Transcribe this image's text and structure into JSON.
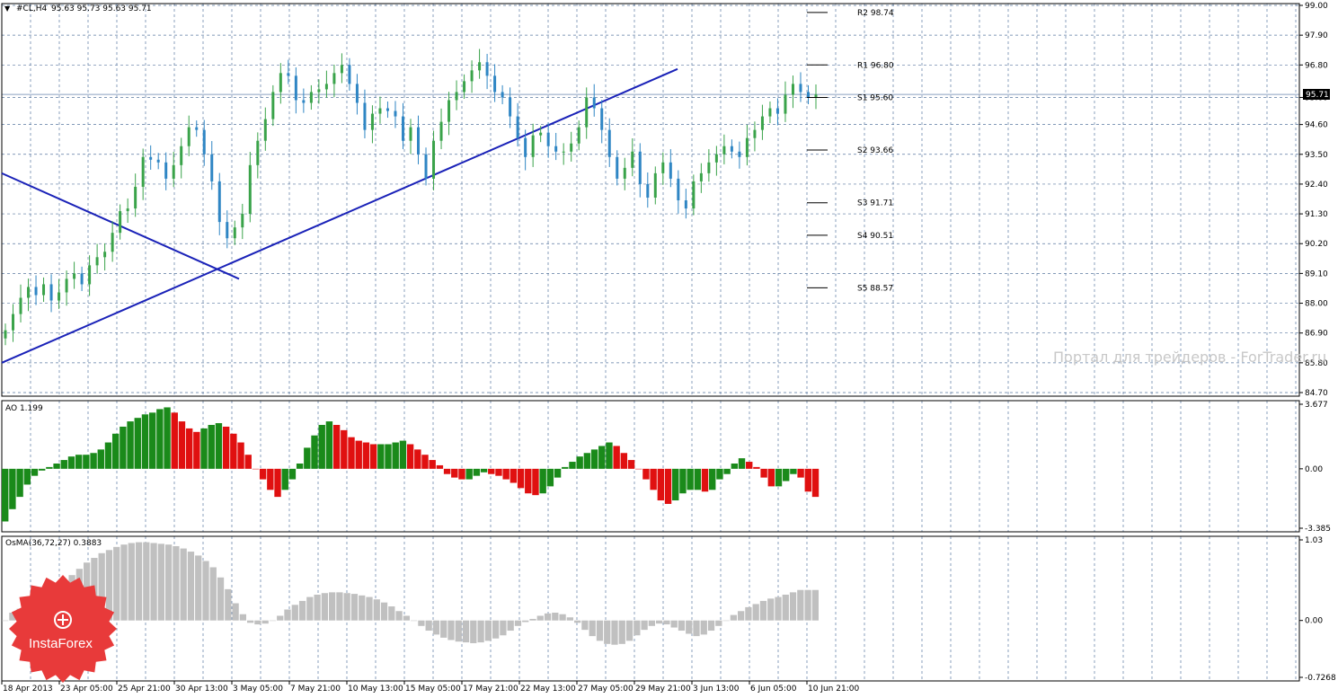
{
  "header": {
    "symbol_label": "#CL,H4",
    "ohlc_label": "95.63 95.73 95.63 95.71"
  },
  "current_price_label": "95.71",
  "watermark": "Портал для трейдеров - ForTrader.ru",
  "logo": {
    "name": "InstaForex",
    "text": "InstaForex",
    "color": "#e83a3a"
  },
  "colors": {
    "bull": "#3aa34a",
    "bear": "#2f86c4",
    "trendline": "#1a22b8",
    "ao_up": "#1a8a1a",
    "ao_down": "#e01010",
    "osma": "#c0c0c0",
    "grid": "#5a78a0",
    "price_line": "#8aa0c0"
  },
  "pivot_levels": [
    {
      "label": "R2 98.74",
      "value": 98.74
    },
    {
      "label": "R1 96.80",
      "value": 96.8
    },
    {
      "label": "S1 95.60",
      "value": 95.6
    },
    {
      "label": "S2 93.66",
      "value": 93.66
    },
    {
      "label": "S3 91.71",
      "value": 91.71
    },
    {
      "label": "S4 90.51",
      "value": 90.51
    },
    {
      "label": "S5 88.57",
      "value": 88.57
    }
  ],
  "ao_label": "AO 1.199",
  "osma_label": "OsMA(36,72,27) 0.3883",
  "chart_data": [
    {
      "type": "candlestick",
      "title": "#CL,H4",
      "current_price": 95.71,
      "ylim": [
        84.7,
        99.0
      ],
      "y_ticks": [
        "99.00",
        "97.90",
        "96.80",
        "95.60",
        "94.60",
        "93.50",
        "92.40",
        "91.30",
        "90.20",
        "89.10",
        "88.00",
        "86.90",
        "85.80",
        "84.70"
      ],
      "x_ticks": [
        "18 Apr 2013",
        "23 Apr 05:00",
        "25 Apr 21:00",
        "30 Apr 13:00",
        "3 May 05:00",
        "7 May 21:00",
        "10 May 13:00",
        "15 May 05:00",
        "17 May 21:00",
        "22 May 13:00",
        "27 May 05:00",
        "29 May 21:00",
        "3 Jun 13:00",
        "6 Jun 05:00",
        "10 Jun 21:00"
      ],
      "grid": true,
      "close_series": [
        87.0,
        87.6,
        88.2,
        88.6,
        88.3,
        88.7,
        88.1,
        88.4,
        88.9,
        89.1,
        88.7,
        89.4,
        89.7,
        89.9,
        90.6,
        91.4,
        91.5,
        92.3,
        93.4,
        93.3,
        93.2,
        92.6,
        93.1,
        93.8,
        94.5,
        94.4,
        93.5,
        92.5,
        91.0,
        90.4,
        90.8,
        91.3,
        93.1,
        94.0,
        94.8,
        95.8,
        96.5,
        96.4,
        95.5,
        95.4,
        95.8,
        95.9,
        96.1,
        96.5,
        96.8,
        96.1,
        95.4,
        94.4,
        95.0,
        95.2,
        95.1,
        94.9,
        94.0,
        94.5,
        93.5,
        92.6,
        94.0,
        94.7,
        95.5,
        95.8,
        96.2,
        96.6,
        96.9,
        96.4,
        95.8,
        95.6,
        94.9,
        94.1,
        93.4,
        94.2,
        94.3,
        93.8,
        93.6,
        93.6,
        93.9,
        94.5,
        95.6,
        95.2,
        94.4,
        93.4,
        92.6,
        93.0,
        93.6,
        92.4,
        91.9,
        92.8,
        93.2,
        92.6,
        91.8,
        91.5,
        92.5,
        92.8,
        93.2,
        93.5,
        93.8,
        93.6,
        93.4,
        94.1,
        94.4,
        94.9,
        95.2,
        95.0,
        95.7,
        96.1,
        95.8,
        95.6,
        95.71
      ],
      "trendlines": [
        {
          "name": "rising support",
          "points": [
            [
              "18 Apr 2013",
              85.8
            ],
            [
              "29 May 21:00",
              96.65
            ]
          ]
        },
        {
          "name": "falling resistance",
          "points": [
            [
              "18 Apr 2013",
              92.8
            ],
            [
              "3 May 05:00",
              88.9
            ]
          ]
        }
      ]
    },
    {
      "type": "bar",
      "title": "AO 1.199",
      "ylim": [
        -3.385,
        3.677
      ],
      "y_ticks": [
        "3.677",
        "0.00",
        "-3.385"
      ],
      "values": [
        -3.0,
        -2.3,
        -1.6,
        -0.9,
        -0.4,
        -0.1,
        0.1,
        0.3,
        0.5,
        0.7,
        0.8,
        0.8,
        0.9,
        1.1,
        1.5,
        2.0,
        2.4,
        2.7,
        2.9,
        3.1,
        3.2,
        3.4,
        3.5,
        3.2,
        2.7,
        2.3,
        2.1,
        2.3,
        2.5,
        2.6,
        2.4,
        2.0,
        1.5,
        0.8,
        0.0,
        -0.6,
        -1.2,
        -1.6,
        -1.2,
        -0.6,
        0.3,
        1.2,
        1.9,
        2.5,
        2.7,
        2.5,
        2.2,
        1.8,
        1.6,
        1.5,
        1.4,
        1.4,
        1.4,
        1.5,
        1.6,
        1.4,
        1.1,
        0.8,
        0.5,
        0.2,
        -0.3,
        -0.5,
        -0.6,
        -0.6,
        -0.4,
        -0.2,
        -0.3,
        -0.4,
        -0.6,
        -0.8,
        -1.1,
        -1.4,
        -1.5,
        -1.4,
        -1.0,
        -0.5,
        0.1,
        0.4,
        0.7,
        0.9,
        1.1,
        1.3,
        1.5,
        1.3,
        0.9,
        0.5,
        0.0,
        -0.6,
        -1.2,
        -1.8,
        -2.0,
        -1.8,
        -1.4,
        -1.2,
        -1.2,
        -1.3,
        -1.2,
        -0.6,
        -0.3,
        0.3,
        0.6,
        0.4,
        0.1,
        -0.5,
        -1.0,
        -1.0,
        -0.7,
        -0.3,
        -0.5,
        -1.3,
        -1.6
      ]
    },
    {
      "type": "bar",
      "title": "OsMA(36,72,27) 0.3883",
      "ylim": [
        -0.7268,
        1.03
      ],
      "y_ticks": [
        "1.03",
        "0.00",
        "-0.7268"
      ],
      "values": [
        0.0,
        0.1,
        0.15,
        0.2,
        0.25,
        0.3,
        0.35,
        0.42,
        0.5,
        0.58,
        0.66,
        0.74,
        0.8,
        0.86,
        0.9,
        0.94,
        0.97,
        0.99,
        1.0,
        1.0,
        0.99,
        0.98,
        0.97,
        0.95,
        0.92,
        0.88,
        0.83,
        0.76,
        0.68,
        0.55,
        0.4,
        0.22,
        0.08,
        -0.03,
        -0.05,
        -0.04,
        0.0,
        0.06,
        0.14,
        0.2,
        0.25,
        0.3,
        0.33,
        0.35,
        0.36,
        0.36,
        0.35,
        0.34,
        0.32,
        0.3,
        0.27,
        0.23,
        0.18,
        0.12,
        0.06,
        0.0,
        -0.07,
        -0.13,
        -0.18,
        -0.22,
        -0.25,
        -0.27,
        -0.28,
        -0.29,
        -0.28,
        -0.26,
        -0.23,
        -0.19,
        -0.13,
        -0.07,
        -0.02,
        0.02,
        0.06,
        0.09,
        0.1,
        0.08,
        0.04,
        -0.03,
        -0.12,
        -0.2,
        -0.26,
        -0.3,
        -0.31,
        -0.3,
        -0.26,
        -0.19,
        -0.12,
        -0.07,
        -0.04,
        -0.05,
        -0.09,
        -0.13,
        -0.17,
        -0.2,
        -0.18,
        -0.13,
        -0.07,
        0.0,
        0.07,
        0.12,
        0.17,
        0.21,
        0.25,
        0.28,
        0.3,
        0.33,
        0.36,
        0.39,
        0.39,
        0.39
      ]
    }
  ]
}
